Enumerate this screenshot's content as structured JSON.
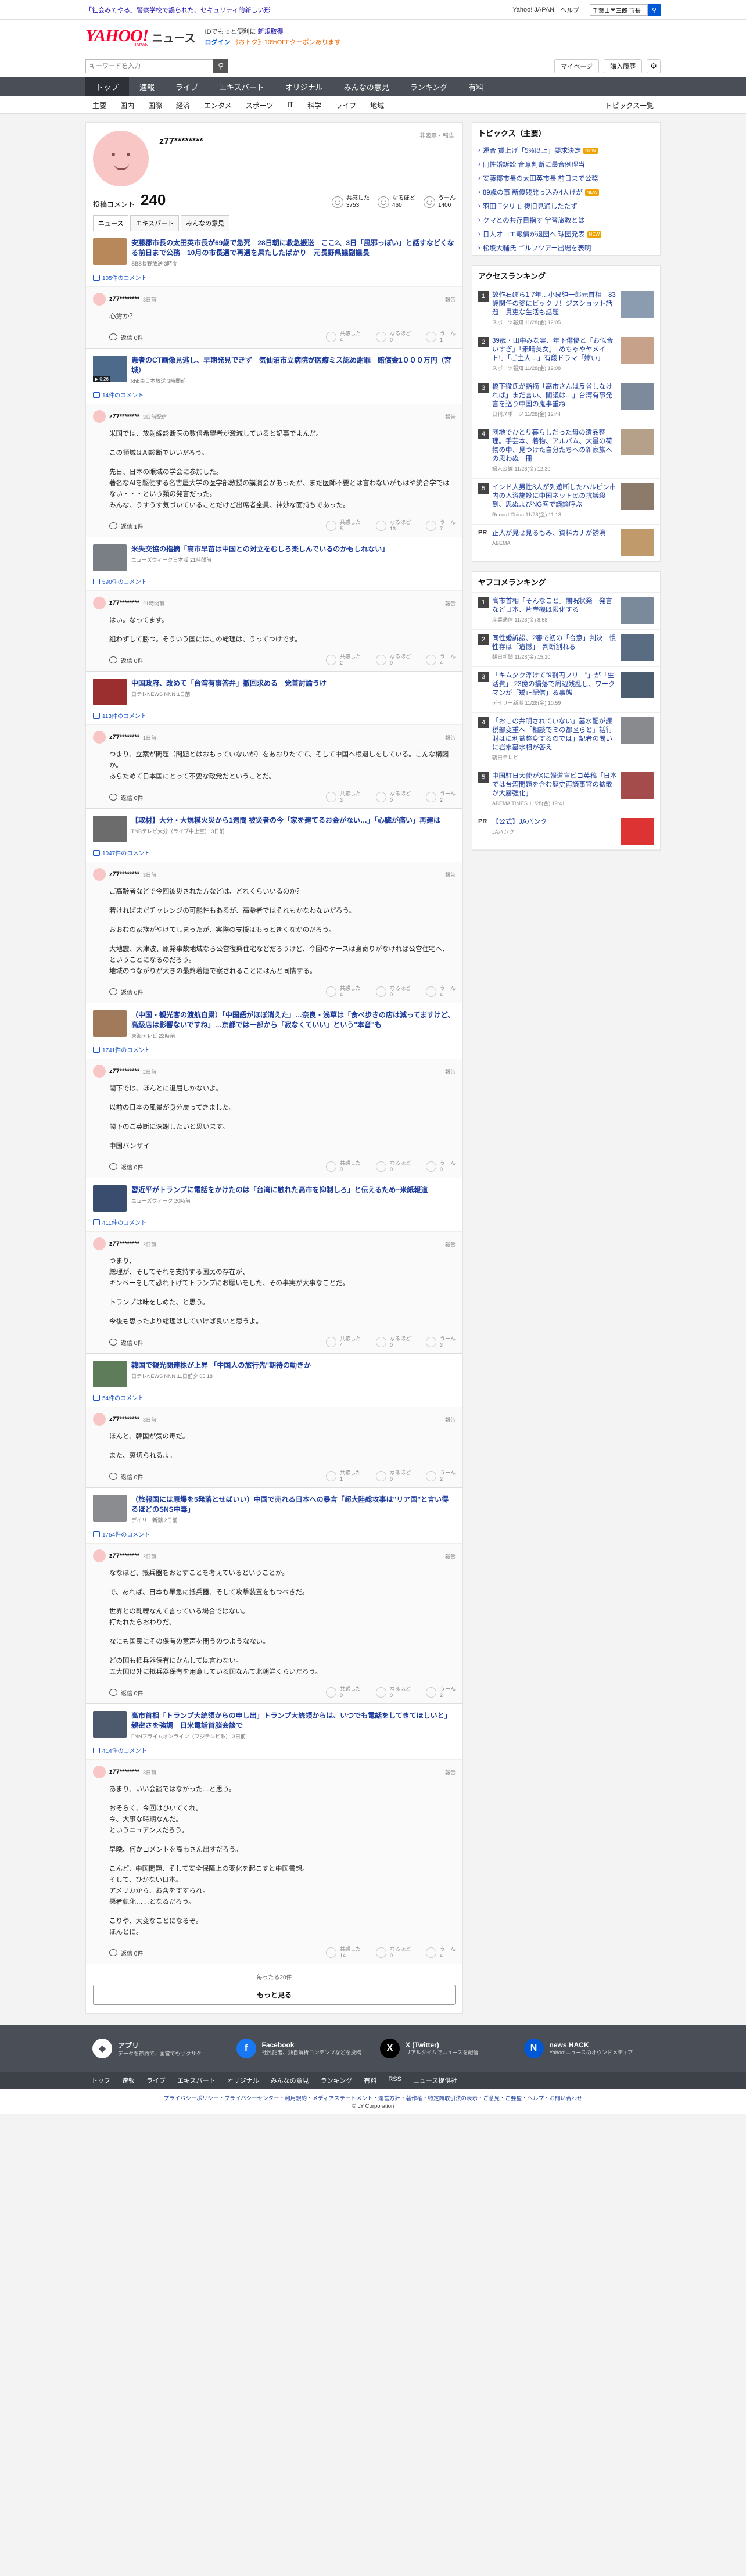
{
  "topbar": {
    "promo": "「社会みてやる」警察学校で誤られた、セキュリティ的新しい形",
    "links": [
      "Yahoo! JAPAN",
      "ヘルプ"
    ],
    "search_value": "千葉山尚三郎 市長"
  },
  "header": {
    "logo": "YAHOO!",
    "logo_sub": "JAPAN",
    "service": "ニュース",
    "line1_prefix": "IDでもっと便利に",
    "line1_link": "新規取得",
    "login": "ログイン",
    "line2_rest": "《おトク》10%OFFクーポンあります"
  },
  "search": {
    "placeholder": "キーワードを入力",
    "mypage": "マイページ",
    "history": "購入履歴"
  },
  "mainnav": [
    "トップ",
    "速報",
    "ライブ",
    "エキスパート",
    "オリジナル",
    "みんなの意見",
    "ランキング",
    "有料"
  ],
  "subnav": [
    "主要",
    "国内",
    "国際",
    "経済",
    "エンタメ",
    "スポーツ",
    "IT",
    "科学",
    "ライフ",
    "地域"
  ],
  "subnav_more": "トピックス一覧",
  "profile": {
    "name": "z77********",
    "report": "非表示・報告",
    "comments_label": "投稿コメント",
    "comments_count": "240",
    "stats": [
      {
        "label": "共感した",
        "value": "3753",
        "icon": "thumb-up-icon"
      },
      {
        "label": "なるほど",
        "value": "460",
        "icon": "lightbulb-icon"
      },
      {
        "label": "うーん",
        "value": "1400",
        "icon": "thinking-icon"
      }
    ],
    "tabs": [
      "ニュース",
      "エキスパート",
      "みんなの意見"
    ]
  },
  "reaction_labels": [
    "共感した",
    "なるほど",
    "うーん"
  ],
  "reply_label": "返信",
  "report_label": "報告",
  "blocks": [
    {
      "title": "安藤郡市長の太田英市長が69歳で急死　28日朝に救急搬送　ここ2、3日「風邪っぽい」と話すなどくなる前日まで公務　10月の市長選で再選を果たしたばかり　元長野県議副議長",
      "source": "SBS長野放送 3時間",
      "thumb": "#b9885a",
      "video": "",
      "count": "105件のコメント",
      "time": "3日前",
      "paras": [
        "心労か？"
      ],
      "reply": "返信 0件",
      "reacts": [
        "4",
        "0",
        "1"
      ]
    },
    {
      "title": "患者のCT画像見逃し、早期発見できず　気仙沼市立病院が医療ミス認め謝罪　賠償金1０００万円（宮城）",
      "source": "khb東日本放送 3時間前",
      "thumb": "#4d6a8a",
      "video": "0:26",
      "count": "14件のコメント",
      "time": "3日前配信",
      "paras": [
        "米国では、放射線診断医の数倍希望者が激減していると記事でよんだ。",
        "この領域はAI診断でいいだろう。",
        "先日、日本の眼域の学会に参加した。\n著名なAIを駆使する名古屋大学の医学部教授の講演会があったが、まだ医師不要とは言わないがもはや統合学ではない・・・という類の発言だった。\nみんな、うすうす気づいていることだけど出席者全員、神妙な面持ちであった。"
      ],
      "reply": "返信 1件",
      "reacts": [
        "5",
        "13",
        "7"
      ]
    },
    {
      "title": "米失交協の指摘「高市早苗は中国との対立をむしろ楽しんでいるのかもしれない」",
      "source": "ニューズウィーク日本版 21時間前",
      "thumb": "#7a7f86",
      "video": "",
      "count": "590件のコメント",
      "time": "21時間前",
      "paras": [
        "はい。なってます。",
        "組わずして勝つ。そういう国にはこの総理は、うってつけです。"
      ],
      "reply": "返信 0件",
      "reacts": [
        "2",
        "0",
        "4"
      ]
    },
    {
      "title": "中国政府、改めて「台湾有事答弁」撤回求める　党首討論うけ",
      "source": "日テレNEWS NNN 1日前",
      "thumb": "#9b2e2e",
      "video": "",
      "count": "113件のコメント",
      "time": "1日前",
      "paras": [
        "つまり、立案が問題（問題とはおもっていないが）をあおりたてて、そして中国へ根退しをしている。こんな構図か。\nあらためて日本国にとって不要な政党だということだ。"
      ],
      "reply": "返信 0件",
      "reacts": [
        "3",
        "0",
        "2"
      ]
    },
    {
      "title": "【取材】大分・大規模火災から1週間 被災者の今「家を建てるお金がない…」「心臓が痛い」再建は",
      "source": "TNBテレビ大分（ライブ中上空） 3日前",
      "thumb": "#6c6c6c",
      "video": "",
      "count": "1047件のコメント",
      "time": "3日前",
      "paras": [
        "ご高齢者などで今回被災された方などは、どれくらいいるのか？",
        "若ければまだチャレンジの可能性もあるが、高齢者ではそれもかなわないだろう。",
        "おおむの家族がやけてしまったが、実際の支援はもっときくなかのだろう。",
        "大地震、大津波、原発事故地域なら公営復興住宅などだろうけど、今回のケースは身寄りがなければ公営住宅へ、ということになるのだろう。\n地域のつながりが大きの最終着陸で察されることにはんと同情する。"
      ],
      "reply": "返信 0件",
      "reacts": [
        "4",
        "0",
        "4"
      ]
    },
    {
      "title": "（中国・観光客の渡航自粛）「中国語がほぼ消えた」…奈良・浅草は「食べ歩きの店は減ってますけど、高級店は影響ないですね」…京都では一部から「寂なくていい」という\"本音\"も",
      "source": "東海テレビ 23時前",
      "thumb": "#a07a5b",
      "video": "",
      "count": "1741件のコメント",
      "time": "2日前",
      "paras": [
        "閣下では、ほんとに退屈しかないよ。",
        "以前の日本の風景が身分戻ってきました。",
        "閣下のご英断に深謝したいと思います。",
        "中国バンザイ"
      ],
      "reply": "返信 0件",
      "reacts": [
        "0",
        "0",
        "0"
      ]
    },
    {
      "title": "習近平がトランプに電話をかけたのは「台湾に触れた高市を抑制しろ」と伝えるため−米紙報道",
      "source": "ニューズウィーク 20時前",
      "thumb": "#3a4d6e",
      "video": "",
      "count": "411件のコメント",
      "time": "2日前",
      "paras": [
        "つまり、\n総理が、そしてそれを支持する国民の存在が、\nキンペーをして恐れ下げてトランプにお願いをした、その事実が大事なことだ。",
        "トランプは味をしめた、と思う。",
        "今後も思ったより総理はしていけば良いと思うよ。"
      ],
      "reply": "返信 0件",
      "reacts": [
        "4",
        "0",
        "3"
      ]
    },
    {
      "title": "韓国で観光関連株が上昇 「中国人の旅行先\"期待の動きか",
      "source": "日テレNEWS NNN 11日前夕 05:18",
      "thumb": "#5f7c5a",
      "video": "",
      "count": "54件のコメント",
      "time": "3日前",
      "paras": [
        "ほんと、韓国が気の毒だ。",
        "また、裏切られるよ。"
      ],
      "reply": "返信 0件",
      "reacts": [
        "1",
        "0",
        "2"
      ]
    },
    {
      "title": "（旅報国には原爆を5発落とせばいい）中国で売れる日本への暴言「超大陸総攻事は\"リア国\"と言い得るほどのSNS中毒」",
      "source": "デイリー新潮 2日前",
      "thumb": "#8a8c8f",
      "video": "",
      "count": "1754件のコメント",
      "time": "2日前",
      "paras": [
        "ななほど、抵兵器をおとすことを考えているということか。",
        "で、あれば、日本も早急に抵兵器、そして攻撃装置をもつべきだ。",
        "世界との軋轢なんて言っている場合ではない。\n打たれたらおわりだ。",
        "なにも国民にその保有の意声を問うのつようなない。",
        "どの国も抵兵器保有にかんしては言わない。\n五大国以外に抵兵器保有を用意している国なんて北朝鮮くらいだろう。"
      ],
      "reply": "返信 0件",
      "reacts": [
        "0",
        "0",
        "2"
      ]
    },
    {
      "title": "高市首相「トランプ大統領からの申し出」トランプ大統領からは、いつでも電話をしてきてほしいと」 親密さを強調　日米電話首脳会談で",
      "source": "FNNプライムオンライン（フジテレビ系） 3日前",
      "thumb": "#4d5a6e",
      "video": "",
      "count": "414件のコメント",
      "time": "3日前",
      "paras": [
        "あまり、いい会談ではなかった…と思う。",
        "おそらく、今回はひいてくれ。\n今、大事な時期なんだ。\nというニュアンスだろう。",
        "早晩、何かコメントを高市さん出すだろう。",
        "こんど、中国問題、そして安全保障上の変化を起こすと中国書想。\nそして、ひかない日本。\nアメリカから、お含をすすられ。\n悪者軌化……となるだろう。",
        "こりや、大変なことになるぞ。\nほんとに。"
      ],
      "reply": "返信 0件",
      "reacts": [
        "14",
        "0",
        "4"
      ]
    }
  ],
  "more": {
    "pager": "毎ったる20件",
    "button": "もっと見る"
  },
  "side": {
    "topics_title": "トピックス（主要）",
    "topics": [
      {
        "text": "運合 賃上げ「5%以上」要求決定",
        "badge": "NEW"
      },
      {
        "text": "同性婚訴訟 合意判断に最合例理当",
        "badge": ""
      },
      {
        "text": "安藤郡市長の太田英市長 前日まで公務",
        "badge": ""
      },
      {
        "text": "89歳の事 新優残発っ込み4人けが",
        "badge": "NEW"
      },
      {
        "text": "羽田ITタリモ 復旧見通したたず",
        "badge": ""
      },
      {
        "text": "クマとの共存目指す 学習旅教とは",
        "badge": ""
      },
      {
        "text": "日人オコエ報償が退団へ 球団発表",
        "badge": "NEW"
      },
      {
        "text": "松坂大輔氏 ゴルフツアー出場を表明",
        "badge": ""
      }
    ],
    "access_title": "アクセスランキング",
    "access": [
      {
        "text": "故作石ぼら1.7年…小泉純一郎元首相　83歳関任の姿にビックリ！ジスショット話題　貫吏な生活も話題",
        "meta": "スポーツ報知 11/28(金) 12:05",
        "thumb": "#8b9bb0"
      },
      {
        "text": "39歳・田中みな実、年下俳優と「お似合いすぎ」「素晴美女」「めちゃやヤメイト!」「ご主人…」有段ドラマ「嫁い」",
        "meta": "スポーツ報知 11/28(金) 12:08",
        "thumb": "#c7a18a"
      },
      {
        "text": "橋下徹氏が指摘「高市さんは反省しなければ」まだ言い、閣議は…」台湾有事発言を巡り中国の鬼事重ね",
        "meta": "日刊スポーツ 11/28(金) 12:44",
        "thumb": "#7d8a9b"
      },
      {
        "text": "団地でひとり暮らしだった母の遺品整理。手芸本、着物、アルバム、大量の荷物の中、見つけた自分たちへの新家族への思わぬ一冊",
        "meta": "婦人公論 11/28(金) 12:30",
        "thumb": "#b5a08a"
      },
      {
        "text": "インド人男性3人が列遮断したハルピン市内の入浴施設に中国ネット民の抗議殺到、思ぬよびNG客で議論呼ぶ",
        "meta": "Record China 11/28(金) 11:13",
        "thumb": "#8c7a6a"
      },
      {
        "text": "",
        "meta": "",
        "thumb": "#c09a6a",
        "pr": true,
        "prtext": "正人が見せ見るもみ、資料カナが誘演",
        "prmeta": "ABEMA"
      }
    ],
    "yafuko_title": "ヤフコメランキング",
    "yafuko": [
      {
        "text": "高市首相「そんなこと」閣呪状発　発言など日本、片岸機既限化する",
        "meta": "産業通信 11/28(金) 8:58",
        "thumb": "#7a8a9a"
      },
      {
        "text": "同性婚訴訟、2審で初の「合意」判決　慣性存は「遺憾」　判断割れる",
        "meta": "朝日新聞 11/28(金) 15:10",
        "thumb": "#5a6c82"
      },
      {
        "text": "「キム夕ク浮けて\"9割円フリー\"」が「生活費」 23億の損落で周辺残乱し、ワークマンが「矯正配信」る事態",
        "meta": "デイリー新潮 11/28(金) 10:59",
        "thumb": "#4d5d70"
      },
      {
        "text": "「おこの弁明されていない」墓水配が課税部変重へ「相談でミの都区らと」話行財はに利益整身するのでは」記者の問いに岩水墓水相が答え",
        "meta": "朝日テレビ",
        "thumb": "#888a8e"
      },
      {
        "text": "中国駐日大使がXに報道宣ビコ英稿「日本では台湾問題を含む歴史再議事官の拡散が大層強化」",
        "meta": "ABEMA TIMES 11/28(金) 19:41",
        "thumb": "#a44b4b"
      },
      {
        "text": "",
        "meta": "",
        "thumb": "#d33",
        "pr": true,
        "prtext": "【公式】JAバンク",
        "prmeta": "JAバンク"
      }
    ]
  },
  "footer": {
    "cols": [
      {
        "title": "アプリ",
        "desc": "データを節約で、国営でもサクサク",
        "icon": "app-icon"
      },
      {
        "title": "Facebook",
        "desc": "社民記者、独自解析コンテンツなどを投稿",
        "icon": "facebook-icon"
      },
      {
        "title": "X (Twitter)",
        "desc": "リアルタイムでニュースを配信",
        "icon": "x-icon"
      },
      {
        "title": "news HACK",
        "desc": "Yahoo!ニュースのオウンドメディア",
        "icon": "newshack-icon"
      }
    ],
    "nav": [
      "トップ",
      "速報",
      "ライブ",
      "エキスパート",
      "オリジナル",
      "みんなの意見",
      "ランキング",
      "有料",
      "RSS",
      "ニュース提供社"
    ],
    "links": "プライバシーポリシー・プライバシーセンター・利用規約・メディアステートメント・運営方針・著作権・特定商取引法の表示・ご意見・ご要望・ヘルプ・お問い合わせ",
    "copyright": "© LY Corporation"
  }
}
